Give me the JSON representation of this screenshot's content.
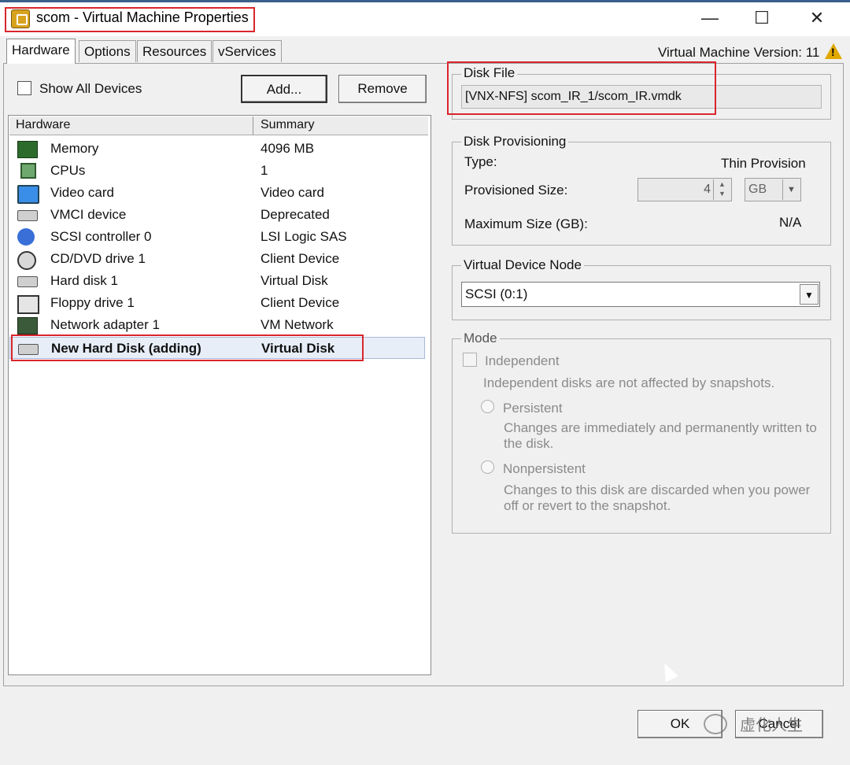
{
  "window": {
    "title": "scom - Virtual Machine Properties",
    "minimize_glyph": "—",
    "maximize_glyph": "☐",
    "close_glyph": "✕"
  },
  "tabs": [
    {
      "label": "Hardware",
      "active": true
    },
    {
      "label": "Options",
      "active": false
    },
    {
      "label": "Resources",
      "active": false
    },
    {
      "label": "vServices",
      "active": false
    }
  ],
  "vm_version": "Virtual Machine Version: 11",
  "toolbar": {
    "show_all_devices_label": "Show All Devices",
    "show_all_devices_checked": false,
    "add_label": "Add...",
    "remove_label": "Remove"
  },
  "hardware_table": {
    "columns": [
      "Hardware",
      "Summary"
    ],
    "rows": [
      {
        "icon": "memory-icon",
        "name": "Memory",
        "summary": "4096 MB"
      },
      {
        "icon": "cpu-icon",
        "name": "CPUs",
        "summary": "1"
      },
      {
        "icon": "video-card-icon",
        "name": "Video card",
        "summary": "Video card"
      },
      {
        "icon": "vmci-icon",
        "name": "VMCI device",
        "summary": "Deprecated"
      },
      {
        "icon": "scsi-controller-icon",
        "name": "SCSI controller 0",
        "summary": "LSI Logic SAS"
      },
      {
        "icon": "cd-dvd-icon",
        "name": "CD/DVD drive 1",
        "summary": "Client Device"
      },
      {
        "icon": "hard-disk-icon",
        "name": "Hard disk 1",
        "summary": "Virtual Disk"
      },
      {
        "icon": "floppy-icon",
        "name": "Floppy drive 1",
        "summary": "Client Device"
      },
      {
        "icon": "network-adapter-icon",
        "name": "Network adapter 1",
        "summary": "VM Network"
      },
      {
        "icon": "hard-disk-icon",
        "name": "New Hard Disk (adding)",
        "summary": "Virtual Disk",
        "selected": true
      }
    ]
  },
  "disk_file": {
    "legend": "Disk File",
    "value": "[VNX-NFS] scom_IR_1/scom_IR.vmdk"
  },
  "disk_provisioning": {
    "legend": "Disk Provisioning",
    "type_label": "Type:",
    "type_value": "Thin Provision",
    "provisioned_size_label": "Provisioned Size:",
    "provisioned_size_value": "4",
    "unit": "GB",
    "max_size_label": "Maximum Size (GB):",
    "max_size_value": "N/A"
  },
  "virtual_device_node": {
    "legend": "Virtual Device Node",
    "selected": "SCSI (0:1)"
  },
  "mode": {
    "legend": "Mode",
    "independent_label": "Independent",
    "independent_desc": "Independent disks are not affected by snapshots.",
    "persistent_label": "Persistent",
    "persistent_desc": "Changes are immediately and permanently written to the disk.",
    "nonpersistent_label": "Nonpersistent",
    "nonpersistent_desc": "Changes to this disk are discarded when you power off or revert to the snapshot."
  },
  "footer": {
    "ok_label": "OK",
    "cancel_label": "Cancel",
    "watermark": "虚化人生"
  },
  "colors": {
    "highlight_box": "#d9262c",
    "selected_row": "#e8eef8"
  }
}
